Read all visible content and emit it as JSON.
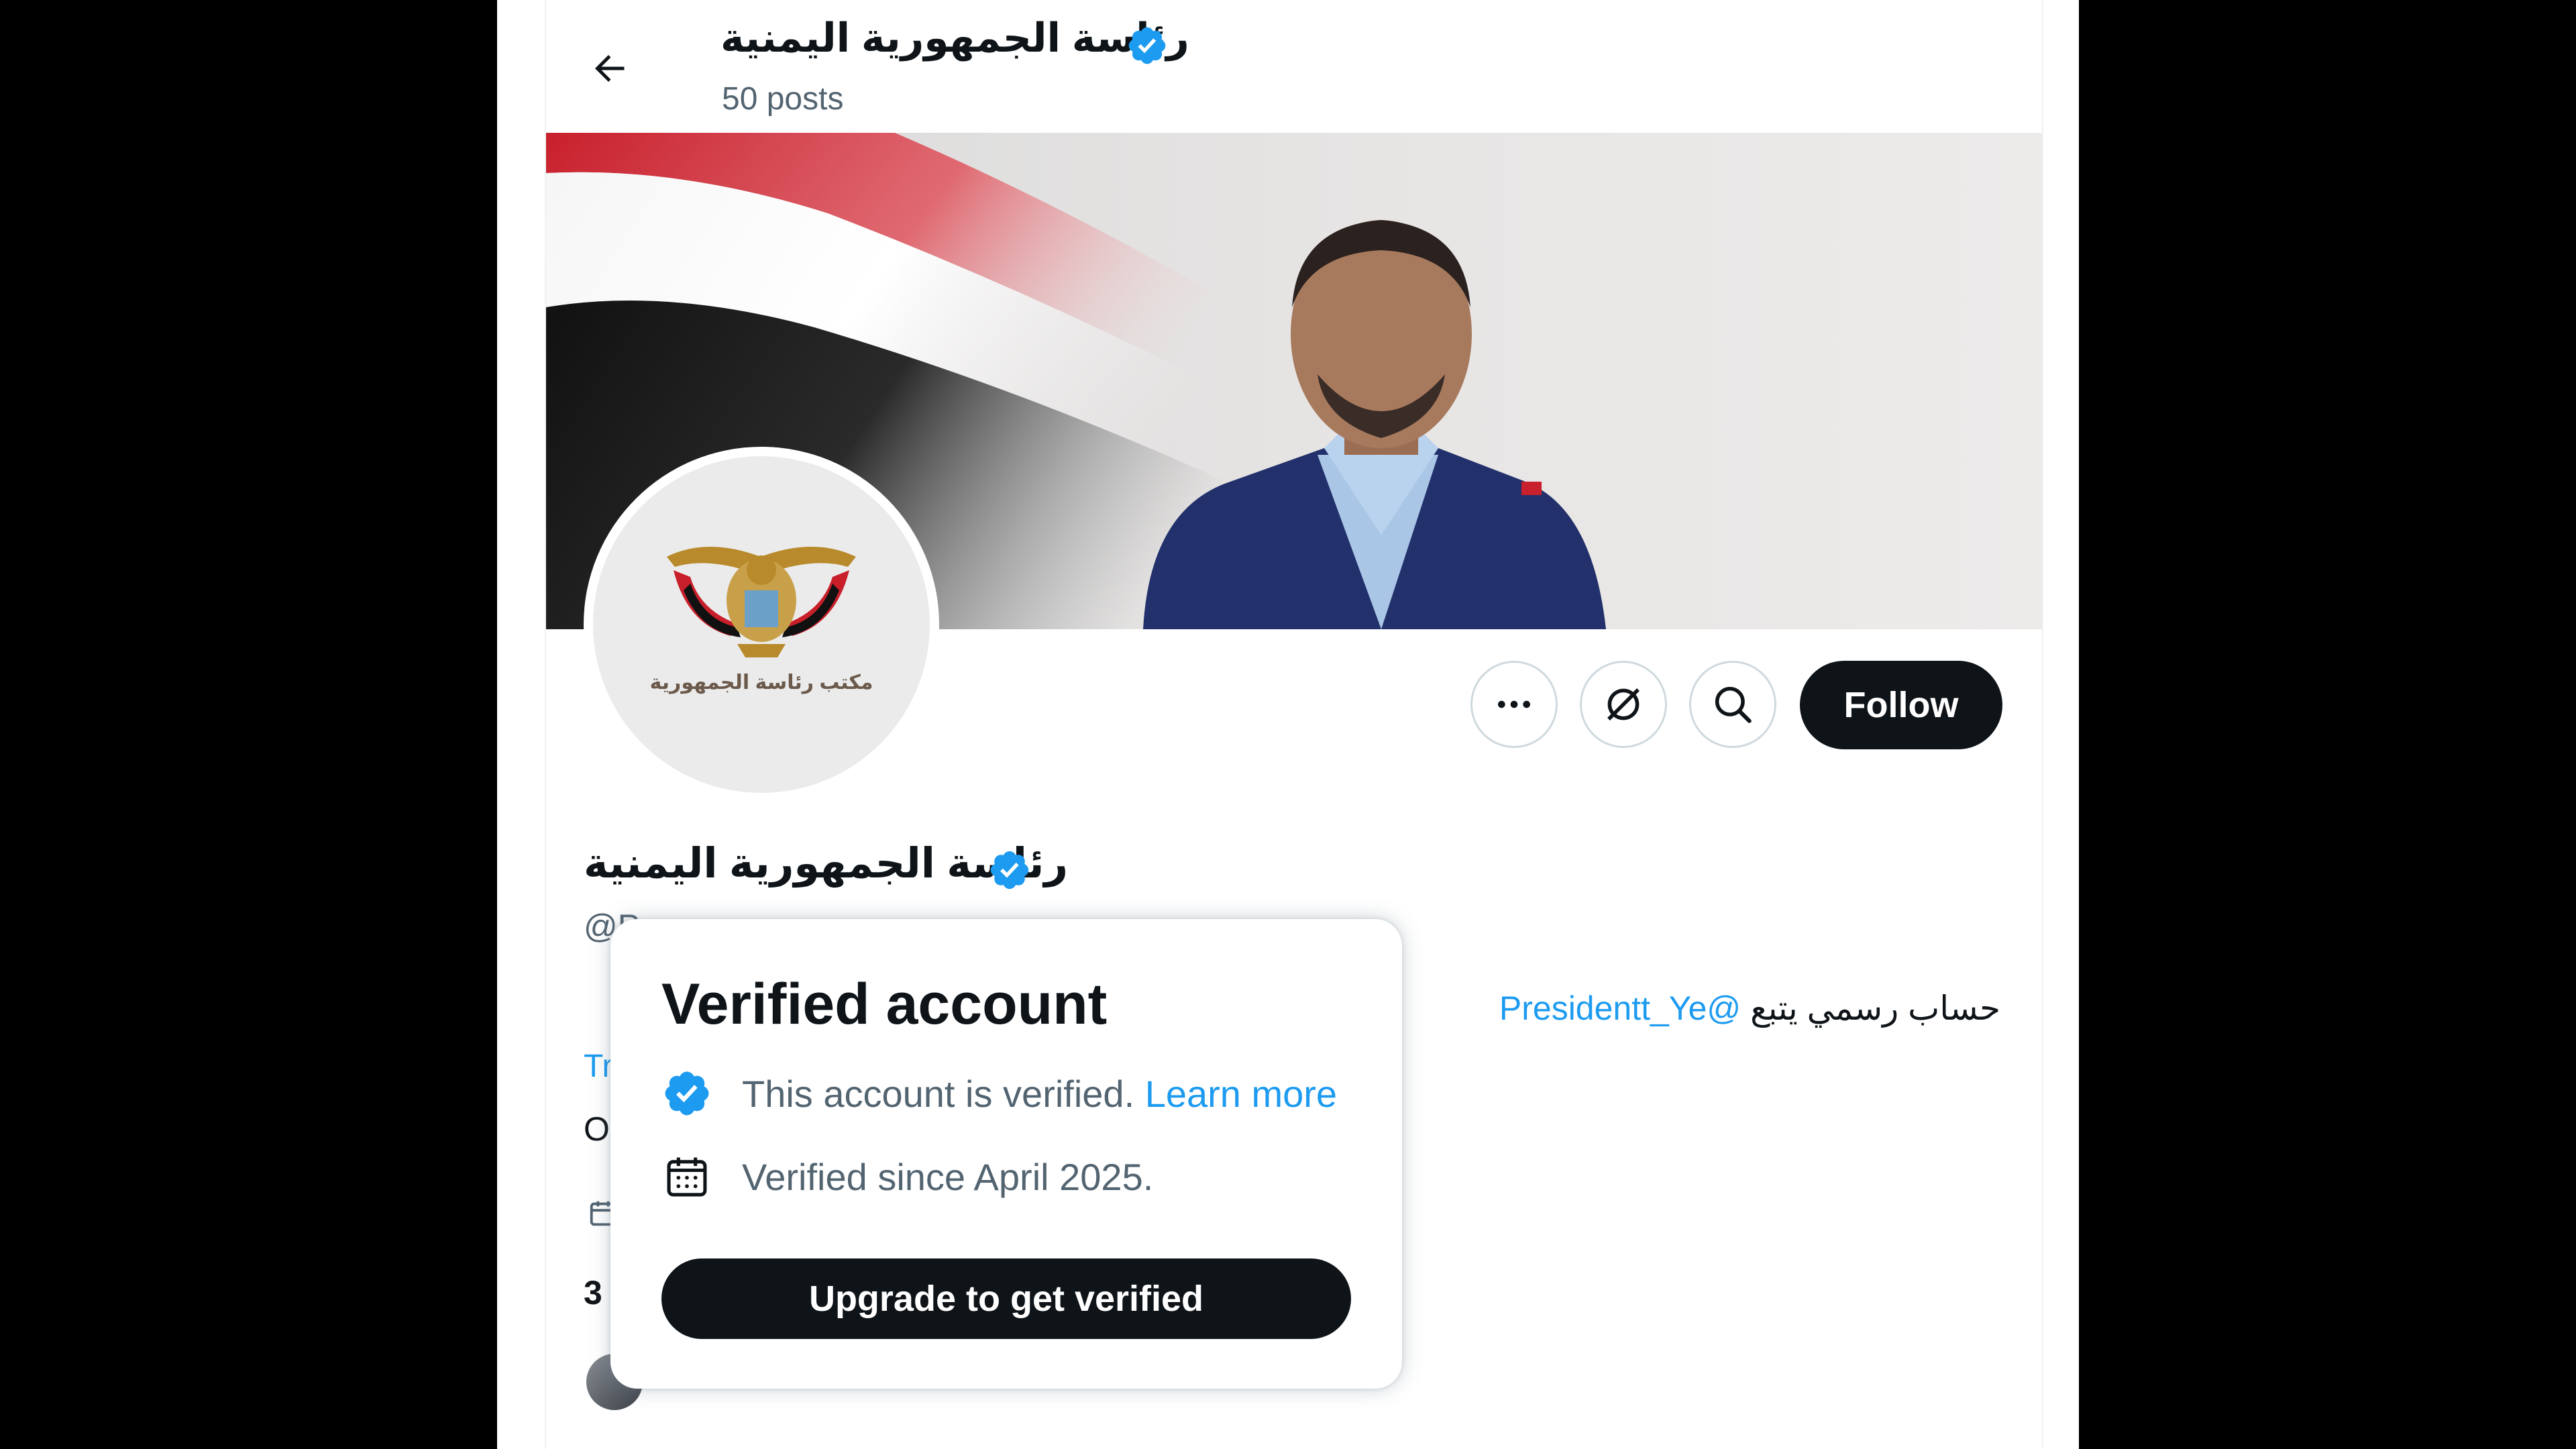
{
  "header": {
    "back_icon": "arrow-left-icon",
    "name": "رئاسة الجمهورية اليمنية",
    "posts": "50 posts"
  },
  "profile": {
    "name": "رئاسة الجمهورية اليمنية",
    "handle": "@P",
    "bio_text": "حساب رسمي يتبع",
    "bio_mention": "@Presidentt_Ye",
    "avatar_caption": "مكتب رئاسة الجمهورية",
    "verified_color": "#1d9bf0"
  },
  "actions": {
    "more_icon": "more-icon",
    "grok_icon": "grok-icon",
    "search_icon": "search-icon",
    "follow_label": "Follow"
  },
  "peek": {
    "translate": "Tr",
    "o": "O",
    "count": "3"
  },
  "popup": {
    "title": "Verified account",
    "row1_text": "This account is verified.",
    "row1_link": "Learn more",
    "row2_text": "Verified since April 2025.",
    "button": "Upgrade to get verified"
  }
}
